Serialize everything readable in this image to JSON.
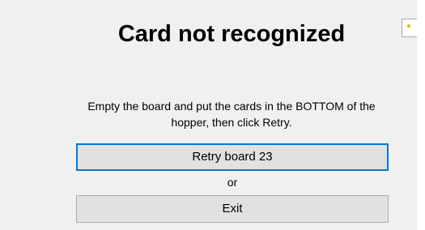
{
  "dialog": {
    "title": "Card not recognized",
    "message_line1": "Empty the board and put the cards in the BOTTOM of the",
    "message_line2": "hopper, then click Retry.",
    "retry_label": "Retry board 23",
    "or_label": "or",
    "exit_label": "Exit"
  },
  "colors": {
    "background": "#f0f0f0",
    "button_face": "#e1e1e1",
    "focus_border": "#0078d7"
  }
}
